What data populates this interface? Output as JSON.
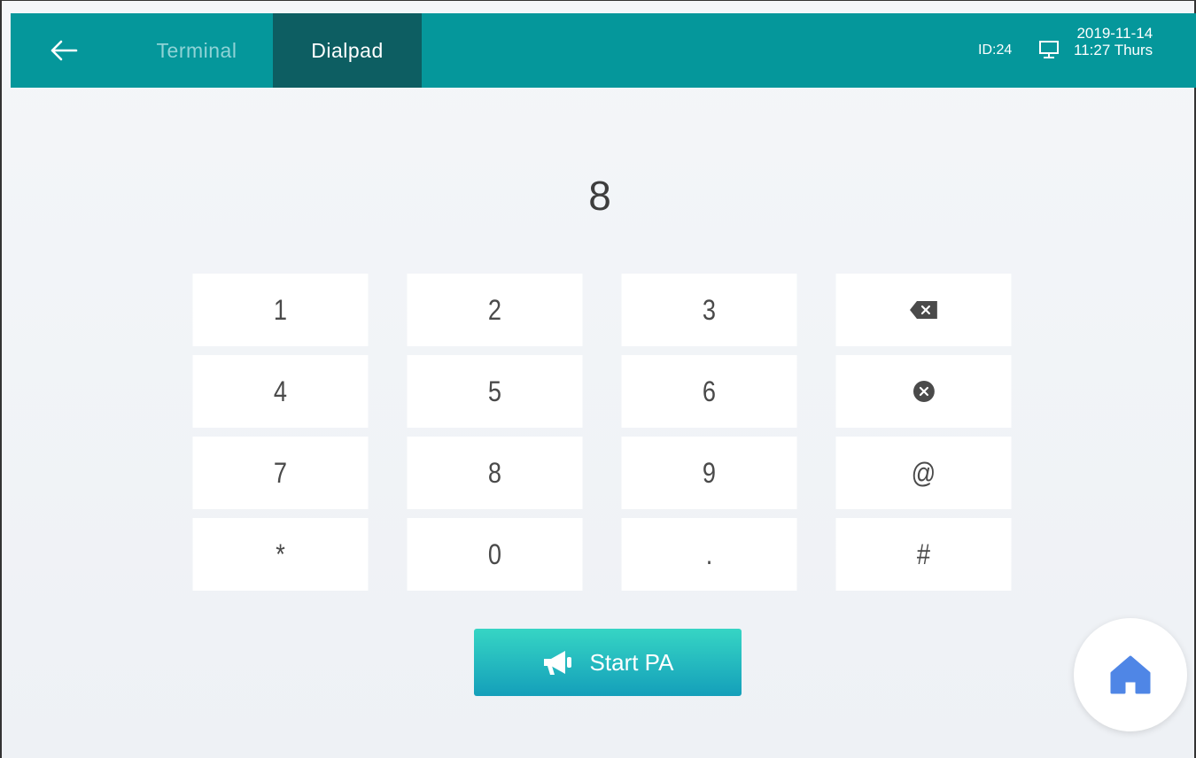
{
  "header": {
    "tabs": [
      {
        "label": "Terminal",
        "active": false
      },
      {
        "label": "Dialpad",
        "active": true
      }
    ],
    "status": {
      "id_text": "ID:24",
      "date": "2019-11-14",
      "time_day": "11:27 Thurs"
    }
  },
  "dialpad": {
    "display_value": "8",
    "keys": [
      "1",
      "2",
      "3",
      "backspace-icon",
      "4",
      "5",
      "6",
      "clear-icon",
      "7",
      "8",
      "9",
      "@",
      "*",
      "0",
      ".",
      "#"
    ]
  },
  "actions": {
    "start_pa_label": "Start PA"
  },
  "colors": {
    "header_bg": "#05979b",
    "active_tab_bg": "#0d5e62",
    "inactive_tab_text": "#8fd3d6",
    "start_pa_gradient_top": "#36d5c4",
    "start_pa_gradient_bottom": "#149fba",
    "home_icon": "#4f86e6"
  },
  "icons": {
    "back": "arrow-left-icon",
    "status": "monitor-icon",
    "pa": "megaphone-icon",
    "home": "home-icon"
  }
}
